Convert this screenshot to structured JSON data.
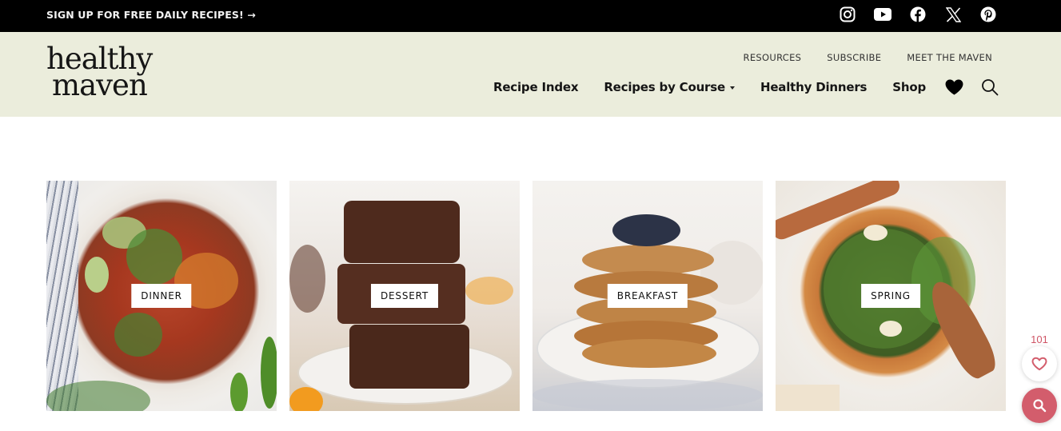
{
  "topbar": {
    "signup_label": "SIGN UP FOR FREE DAILY RECIPES! →",
    "socials": [
      {
        "name": "instagram-icon",
        "label": "Instagram"
      },
      {
        "name": "youtube-icon",
        "label": "YouTube"
      },
      {
        "name": "facebook-icon",
        "label": "Facebook"
      },
      {
        "name": "x-icon",
        "label": "X"
      },
      {
        "name": "pinterest-icon",
        "label": "Pinterest"
      }
    ]
  },
  "header": {
    "logo_line1": "healthy",
    "logo_line2": "maven",
    "background": "#ebeddc",
    "subnav": [
      "RESOURCES",
      "SUBSCRIBE",
      "MEET THE MAVEN"
    ],
    "mainnav": [
      {
        "label": "Recipe Index",
        "dropdown": false
      },
      {
        "label": "Recipes by Course",
        "dropdown": true
      },
      {
        "label": "Healthy Dinners",
        "dropdown": false
      },
      {
        "label": "Shop",
        "dropdown": false
      }
    ],
    "icons": [
      "heart-icon",
      "search-icon"
    ]
  },
  "categories": [
    {
      "label": "DINNER",
      "image": "vegetarian chili bowl with avocado and cilantro"
    },
    {
      "label": "DESSERT",
      "image": "stack of chocolate brownies on plate"
    },
    {
      "label": "BREAKFAST",
      "image": "stack of pancakes topped with blueberries"
    },
    {
      "label": "SPRING",
      "image": "asparagus arugula salad in orange bowl"
    }
  ],
  "floating": {
    "favorites_count": "101",
    "accent": "#d35d6c"
  }
}
